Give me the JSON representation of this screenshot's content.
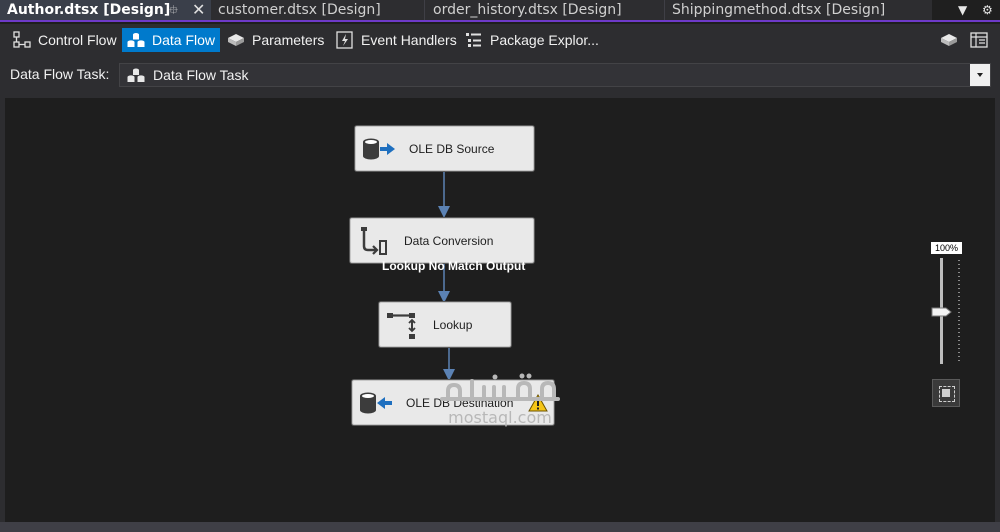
{
  "tabs": [
    {
      "label": "Author.dtsx [Design]",
      "active": true
    },
    {
      "label": "customer.dtsx [Design]",
      "active": false
    },
    {
      "label": "order_history.dtsx [Design]",
      "active": false
    },
    {
      "label": "Shippingmethod.dtsx [Design]",
      "active": false
    }
  ],
  "tab_controls": {
    "pin_icon": "pin-icon",
    "close_icon": "close-icon",
    "dropdown_icon": "tab-list-dropdown-icon",
    "settings_icon": "gear-icon"
  },
  "toolbar": {
    "items": [
      {
        "label": "Control Flow",
        "icon": "control-flow-icon",
        "active": false
      },
      {
        "label": "Data Flow",
        "icon": "data-flow-icon",
        "active": true
      },
      {
        "label": "Parameters",
        "icon": "parameters-icon",
        "active": false
      },
      {
        "label": "Event Handlers",
        "icon": "event-handlers-icon",
        "active": false
      },
      {
        "label": "Package Explor...",
        "icon": "package-explorer-icon",
        "active": false
      }
    ],
    "right_icons": [
      "toolbox-icon",
      "variables-icon"
    ]
  },
  "task_selector": {
    "label": "Data Flow Task:",
    "value": "Data Flow Task",
    "icon": "data-flow-task-icon"
  },
  "canvas": {
    "components": [
      {
        "label": "OLE DB Source",
        "icon": "ole-db-source-icon",
        "warning": false
      },
      {
        "label": "Data Conversion",
        "icon": "data-conversion-icon",
        "warning": false
      },
      {
        "label": "Lookup",
        "icon": "lookup-icon",
        "warning": false
      },
      {
        "label": "OLE DB Destination",
        "icon": "ole-db-destination-icon",
        "warning": true
      }
    ],
    "path_label": "Lookup No Match Output",
    "zoom": {
      "label": "100%",
      "level_percent": 100
    }
  },
  "watermark": {
    "logo_text": "مستقل",
    "text": "mostaql.com"
  },
  "colors": {
    "accent": "#007acc",
    "tab_underline": "#6e3ac9",
    "connector": "#5b82b4",
    "component_bg": "#e9e9e9",
    "canvas_bg": "#1e1e1e"
  }
}
